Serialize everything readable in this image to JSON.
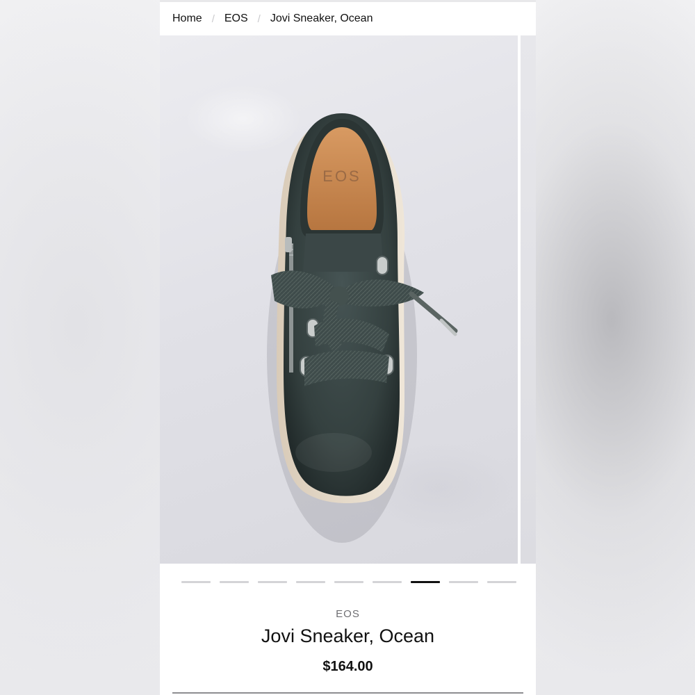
{
  "breadcrumb": {
    "items": [
      "Home",
      "EOS",
      "Jovi Sneaker, Ocean"
    ],
    "separator": "/"
  },
  "gallery": {
    "image": "shoe-photo",
    "image_logo": "EOS",
    "slide_count": 9,
    "active_slide": 7
  },
  "product": {
    "brand": "EOS",
    "name": "Jovi Sneaker, Ocean",
    "price": "$164.00"
  },
  "colors": {
    "shoe": "#3a4646",
    "lining": "#c98854",
    "active_dot": "#111111",
    "inactive_dot": "#d4d4d7"
  }
}
